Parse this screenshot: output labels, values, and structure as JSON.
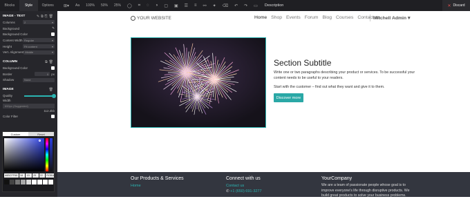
{
  "topbar": {
    "tabs": [
      "Blocks",
      "Style",
      "Options"
    ],
    "active_tab": "Style",
    "tools": [
      "Aa",
      "100%",
      "50%",
      "25%"
    ],
    "description_label": "Description",
    "discard_label": "Discard"
  },
  "sidebar": {
    "image_text": {
      "title": "IMAGE - TEXT",
      "columns_label": "Columns",
      "columns_value": "2",
      "background_label": "Background",
      "background_color_label": "Background Color",
      "content_width_label": "Content Width",
      "content_width_value": "Regular",
      "height_label": "Height",
      "height_value": "Fit content",
      "vert_alignment_label": "Vert. Alignment",
      "vert_alignment_value": "Middle"
    },
    "column": {
      "title": "COLUMN",
      "background_color_label": "Background Color",
      "border_label": "Border",
      "border_value": "0",
      "border_unit": "px",
      "shadow_label": "Shadow",
      "shadow_value": "None"
    },
    "image": {
      "title": "IMAGE",
      "quality_label": "Quality",
      "quality_level": 0.95,
      "width_label": "Width",
      "width_value": "690px (Suggested)",
      "size_value": "112.2kb",
      "color_filter_label": "Color Filter"
    },
    "picker": {
      "tab_custom": "Custom",
      "tab_reset": "Reset",
      "hex": "#6BCFF68",
      "r": "18",
      "g": "19",
      "b": "29",
      "a": "22",
      "mode": "RGBA"
    }
  },
  "site": {
    "logo_text": "YOUR WEBSITE",
    "menu": [
      "Home",
      "Shop",
      "Events",
      "Forum",
      "Blog",
      "Courses",
      "Contact us"
    ],
    "active_menu": "Home",
    "user_label": "Mitchell Admin ▾",
    "section_subtitle": "Section Subtitle",
    "paragraph1": "Write one or two paragraphs describing your product or services. To be successful your content needs to be useful to your readers.",
    "paragraph2": "Start with the customer – find out what they want and give it to them.",
    "cta_label": "Discover more"
  },
  "footer": {
    "col1_title": "Our Products & Services",
    "col1_link": "Home",
    "col2_title": "Connect with us",
    "col2_link": "Contact us",
    "col2_phone": "+1 (650) 691-3277",
    "col3_title": "YourCompany",
    "col3_text": "We are a team of passionate people whose goal is to improve everyone's life through disruptive products. We build great products to solve your business problems."
  },
  "colors": {
    "accent": "#2bb5b2",
    "topbar_bg": "#1f1f23",
    "sidebar_bg": "#26262b",
    "footer_bg": "#33363f",
    "discard_icon": "#e05050"
  }
}
